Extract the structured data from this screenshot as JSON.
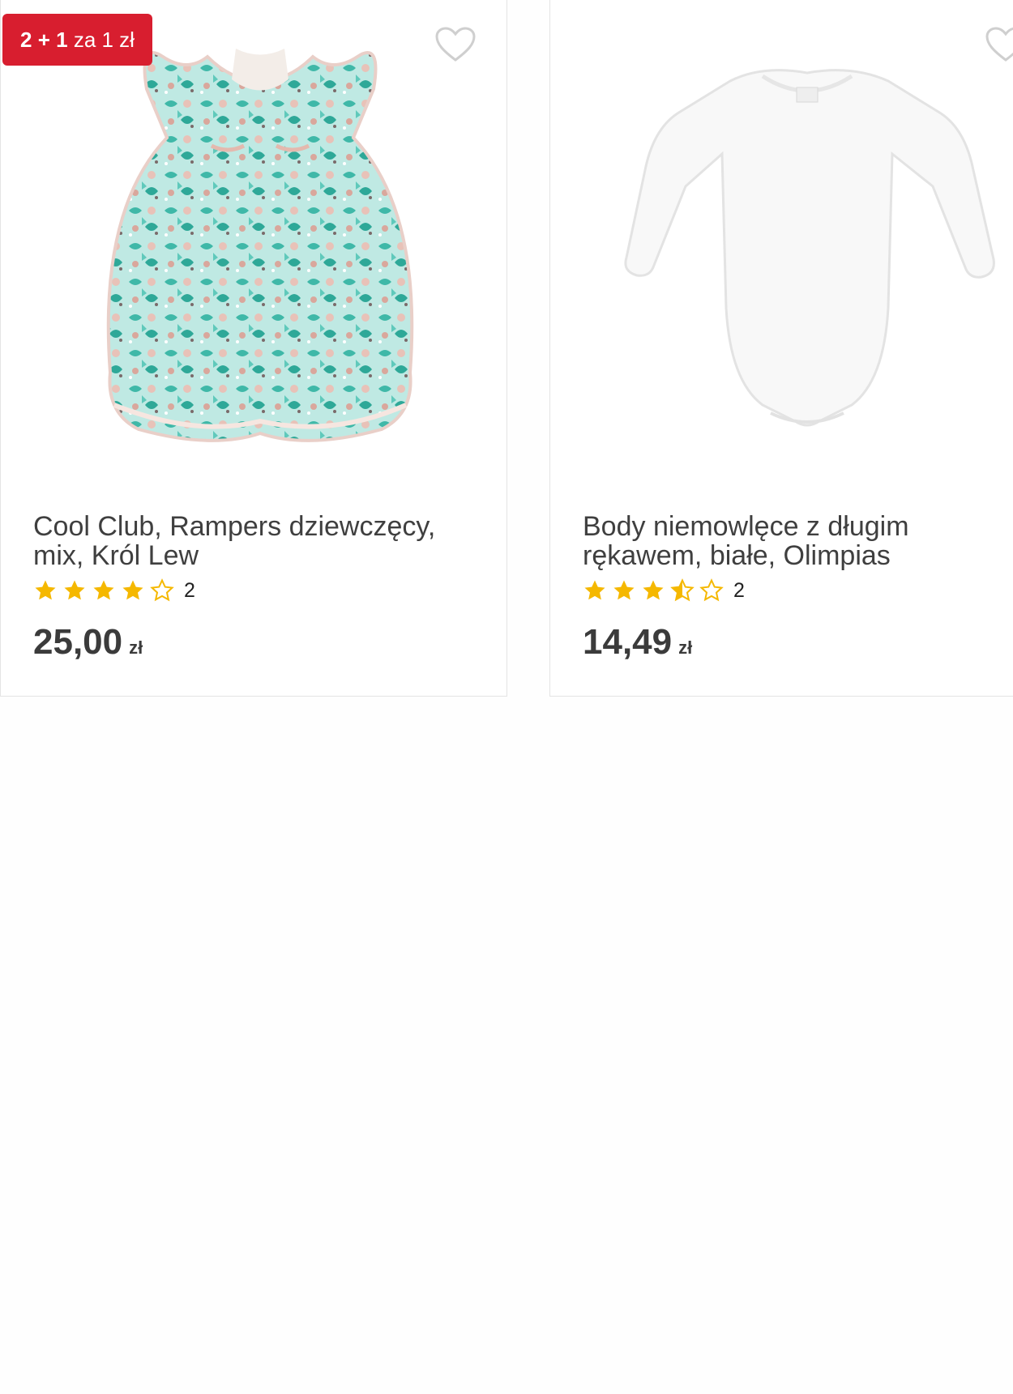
{
  "products": [
    {
      "badge": {
        "main": "2 + 1",
        "rest": "za 1 zł",
        "color": "#d81e2f"
      },
      "wishlist_icon": "heart-outline-icon",
      "image": "floral-girls-romper",
      "title": "Cool Club, Rampers dziewczęcy, mix, Król Lew",
      "rating": {
        "value": 4,
        "max": 5,
        "count": "2"
      },
      "price": "25,00",
      "currency": "zł"
    },
    {
      "wishlist_icon": "heart-outline-icon",
      "image": "white-long-sleeve-bodysuit",
      "title": "Body niemowlęce z długim rękawem, białe, Olimpias",
      "rating": {
        "value": 3.5,
        "max": 5,
        "count": "2"
      },
      "price": "14,49",
      "currency": "zł"
    }
  ],
  "colors": {
    "star": "#f5b800",
    "badge": "#d81e2f",
    "text": "#3f3f3f"
  }
}
